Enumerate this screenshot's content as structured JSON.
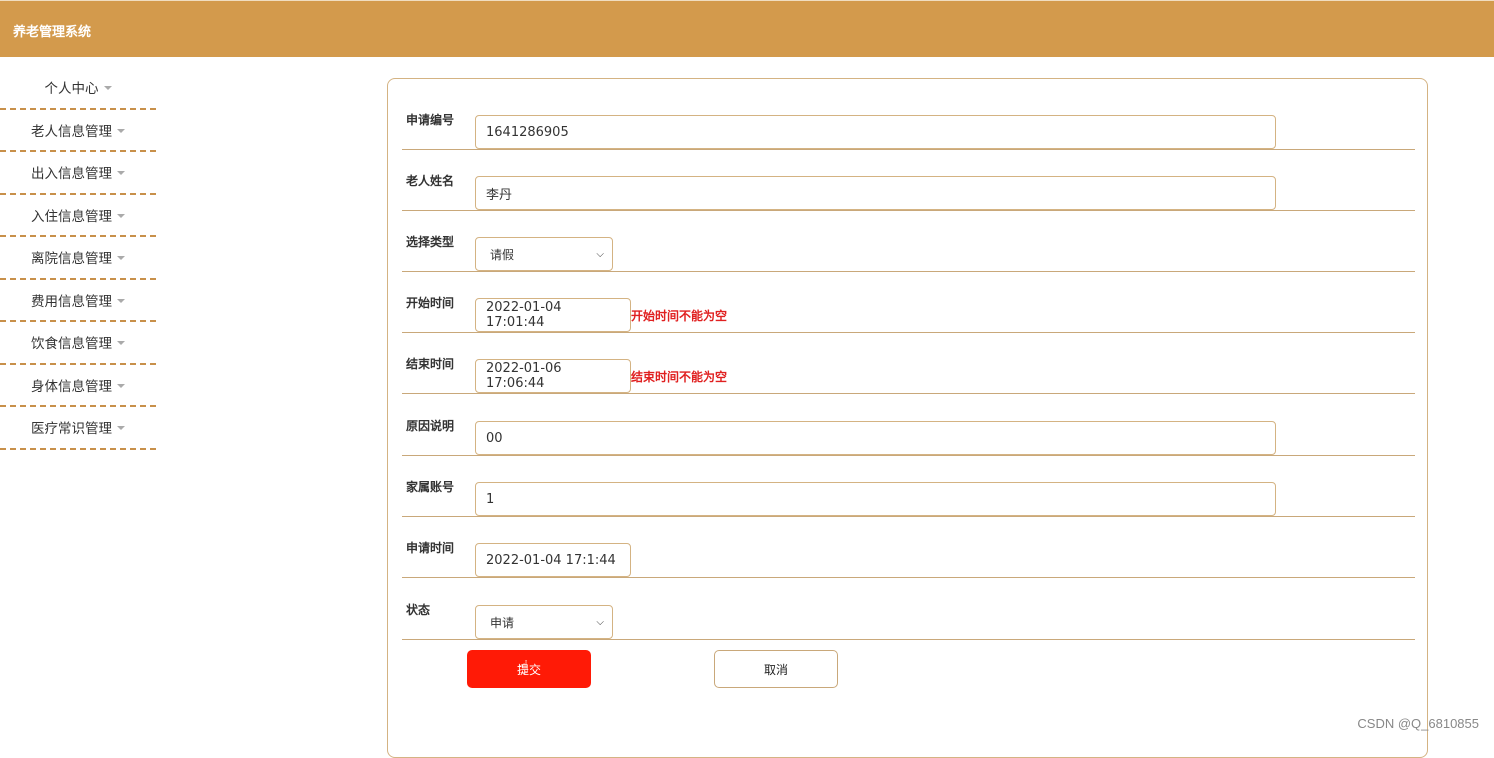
{
  "header": {
    "title": "养老管理系统",
    "color": "#d39a4c"
  },
  "sidebar": {
    "items": [
      {
        "label": "个人中心"
      },
      {
        "label": "老人信息管理"
      },
      {
        "label": "出入信息管理"
      },
      {
        "label": "入住信息管理"
      },
      {
        "label": "离院信息管理"
      },
      {
        "label": "费用信息管理"
      },
      {
        "label": "饮食信息管理"
      },
      {
        "label": "身体信息管理"
      },
      {
        "label": "医疗常识管理"
      }
    ]
  },
  "form": {
    "apply_no": {
      "label": "申请编号",
      "value": "1641286905"
    },
    "elder_name": {
      "label": "老人姓名",
      "value": "李丹"
    },
    "type": {
      "label": "选择类型",
      "value": "请假"
    },
    "start_time": {
      "label": "开始时间",
      "value": "2022-01-04 17:01:44",
      "error": "开始时间不能为空"
    },
    "end_time": {
      "label": "结束时间",
      "value": "2022-01-06 17:06:44",
      "error": "结束时间不能为空"
    },
    "reason": {
      "label": "原因说明",
      "value": "00"
    },
    "family_account": {
      "label": "家属账号",
      "value": "1"
    },
    "apply_time": {
      "label": "申请时间",
      "value": "2022-01-04 17:1:44"
    },
    "status": {
      "label": "状态",
      "value": "申请"
    }
  },
  "actions": {
    "submit_label": "提交",
    "cancel_label": "取消",
    "submit_color": "#ff1a06"
  },
  "watermark": "CSDN @Q_6810855"
}
